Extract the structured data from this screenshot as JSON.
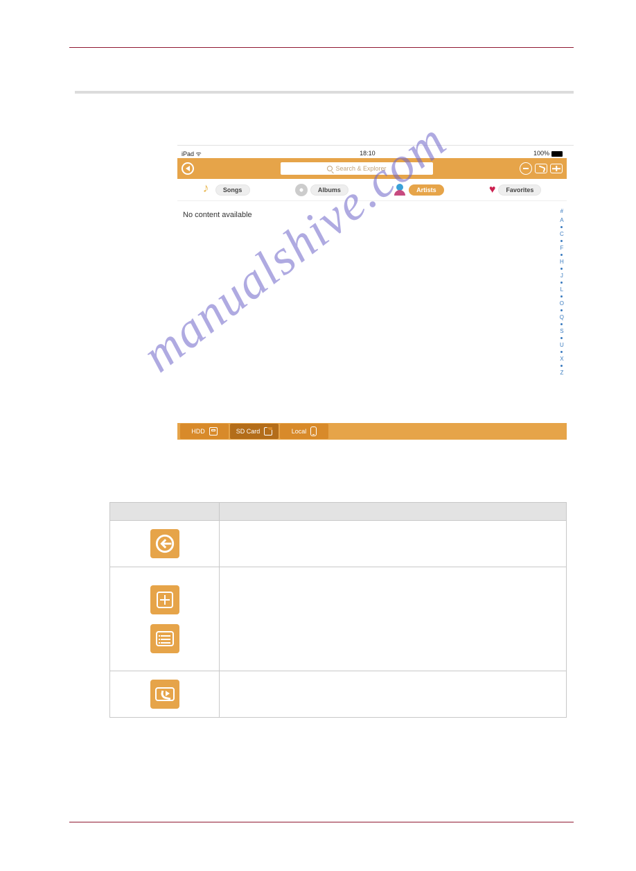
{
  "statusbar": {
    "carrier": "iPad",
    "wifi": "wifi-icon",
    "time": "18:10",
    "battery": "100%"
  },
  "topbar": {
    "search_placeholder": "Search & Explorer"
  },
  "categories": {
    "songs": "Songs",
    "albums": "Albums",
    "artists": "Artists",
    "favorites": "Favorites"
  },
  "content": {
    "no_content": "No content available"
  },
  "alpha_index": [
    "#",
    "A",
    "•",
    "C",
    "•",
    "F",
    "•",
    "H",
    "•",
    "J",
    "•",
    "L",
    "•",
    "O",
    "•",
    "Q",
    "•",
    "S",
    "•",
    "U",
    "•",
    "X",
    "•",
    "Z"
  ],
  "bottom_tabs": {
    "hdd": "HDD",
    "sd": "SD Card",
    "local": "Local"
  },
  "watermark": "manualshive.com"
}
